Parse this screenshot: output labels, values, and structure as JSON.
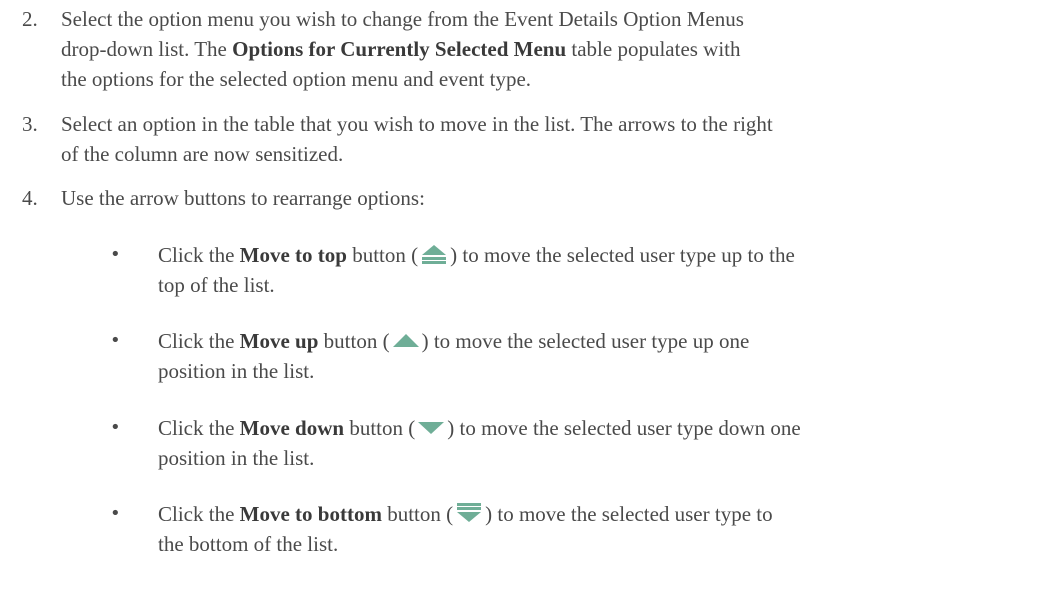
{
  "steps": [
    {
      "number": "2.",
      "lines": [
        "Select the option menu you wish to change from the Event Details Option Menus",
        "drop-down list. The ",
        "Options for Currently Selected Menu",
        " table populates with",
        "the options for the selected option menu and event type."
      ]
    },
    {
      "number": "3.",
      "line1": "Select an option in the table that you wish to move in the list. The arrows to the right",
      "line2": "of the column are now sensitized."
    },
    {
      "number": "4.",
      "line1": "Use the arrow buttons to rearrange options:"
    }
  ],
  "bullets": [
    {
      "symbol": "•",
      "prefix": "Click the ",
      "bold": "Move to top",
      "mid": " button (",
      "icon": "move-to-top-icon",
      "after": ") to move the selected user type up to the",
      "line2": "top of the list."
    },
    {
      "symbol": "•",
      "prefix": "Click the ",
      "bold": "Move up",
      "mid": " button (",
      "icon": "move-up-icon",
      "after": ") to move the selected user type up one",
      "line2": "position in the list."
    },
    {
      "symbol": "•",
      "prefix": "Click the ",
      "bold": "Move down",
      "mid": " button (",
      "icon": "move-down-icon",
      "after": ") to move the selected user type down one",
      "line2": "position in the list."
    },
    {
      "symbol": "•",
      "prefix": "Click the ",
      "bold": "Move to bottom",
      "mid": " button (",
      "icon": "move-to-bottom-icon",
      "after": ") to move the selected user type to",
      "line2": "the bottom of the list."
    }
  ],
  "colors": {
    "text": "#4a4a4a",
    "icon_fill": "#6fae97"
  }
}
